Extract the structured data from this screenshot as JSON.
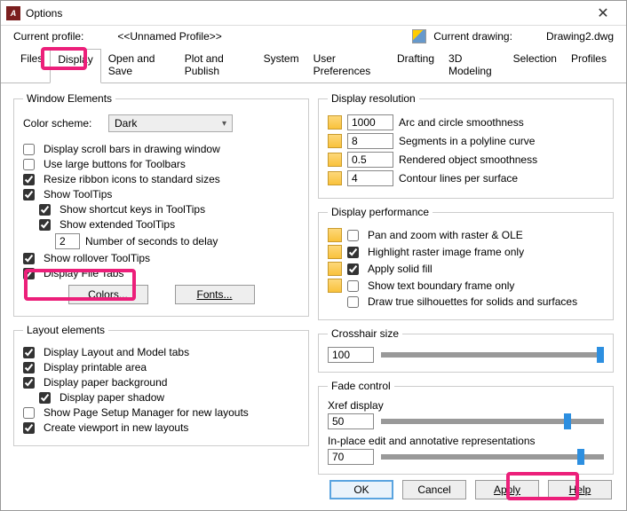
{
  "window": {
    "title": "Options"
  },
  "header": {
    "profile_label": "Current profile:",
    "profile_value": "<<Unnamed Profile>>",
    "drawing_label": "Current drawing:",
    "drawing_value": "Drawing2.dwg"
  },
  "tabs": {
    "files": "Files",
    "display": "Display",
    "opensave": "Open and Save",
    "plotpublish": "Plot and Publish",
    "system": "System",
    "userprefs": "User Preferences",
    "drafting": "Drafting",
    "modeling3d": "3D Modeling",
    "selection": "Selection",
    "profiles": "Profiles"
  },
  "windowElements": {
    "legend": "Window Elements",
    "colorScheme_label": "Color scheme:",
    "colorScheme_value": "Dark",
    "scrollBars": "Display scroll bars in drawing window",
    "largeButtons": "Use large buttons for Toolbars",
    "resizeRibbon": "Resize ribbon icons to standard sizes",
    "showToolTips": "Show ToolTips",
    "shortcutKeys": "Show shortcut keys in ToolTips",
    "extended": "Show extended ToolTips",
    "seconds_value": "2",
    "seconds_label": "Number of seconds to delay",
    "rollover": "Show rollover ToolTips",
    "fileTabs": "Display File Tabs",
    "colorsBtn": "Colors...",
    "fontsBtn": "Fonts..."
  },
  "layoutElements": {
    "legend": "Layout elements",
    "layoutModel": "Display Layout and Model tabs",
    "printable": "Display printable area",
    "paperBg": "Display paper background",
    "paperShadow": "Display paper shadow",
    "pageSetup": "Show Page Setup Manager for new layouts",
    "createVp": "Create viewport in new layouts"
  },
  "displayRes": {
    "legend": "Display resolution",
    "arc_val": "1000",
    "arc_lbl": "Arc and circle smoothness",
    "seg_val": "8",
    "seg_lbl": "Segments in a polyline curve",
    "ren_val": "0.5",
    "ren_lbl": "Rendered object smoothness",
    "con_val": "4",
    "con_lbl": "Contour lines per surface"
  },
  "displayPerf": {
    "legend": "Display performance",
    "panZoom": "Pan and zoom with raster & OLE",
    "hlRaster": "Highlight raster image frame only",
    "solidFill": "Apply solid fill",
    "textBound": "Show text boundary frame only",
    "trueSil": "Draw true silhouettes for solids and surfaces"
  },
  "crosshair": {
    "legend": "Crosshair size",
    "value": "100"
  },
  "fade": {
    "legend": "Fade control",
    "xref_label": "Xref display",
    "xref_value": "50",
    "inplace_label": "In-place edit and annotative representations",
    "inplace_value": "70"
  },
  "buttons": {
    "ok": "OK",
    "cancel": "Cancel",
    "apply": "Apply",
    "help": "Help"
  }
}
